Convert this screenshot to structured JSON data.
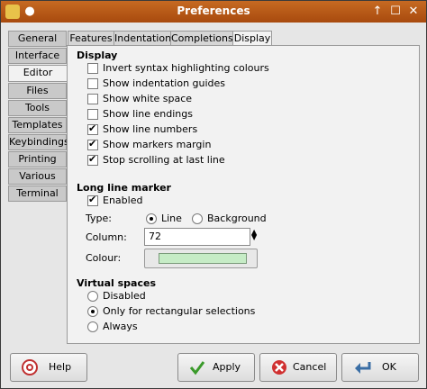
{
  "window": {
    "title": "Preferences"
  },
  "categories": [
    "General",
    "Interface",
    "Editor",
    "Files",
    "Tools",
    "Templates",
    "Keybindings",
    "Printing",
    "Various",
    "Terminal"
  ],
  "tabs": [
    "Features",
    "Indentation",
    "Completions",
    "Display"
  ],
  "display": {
    "heading": "Display",
    "options": [
      {
        "label": "Invert syntax highlighting colours",
        "checked": false
      },
      {
        "label": "Show indentation guides",
        "checked": false
      },
      {
        "label": "Show white space",
        "checked": false
      },
      {
        "label": "Show line endings",
        "checked": false
      },
      {
        "label": "Show line numbers",
        "checked": true
      },
      {
        "label": "Show markers margin",
        "checked": true
      },
      {
        "label": "Stop scrolling at last line",
        "checked": true
      }
    ]
  },
  "long_line": {
    "heading": "Long line marker",
    "enabled_label": "Enabled",
    "type_label": "Type:",
    "type_line": "Line",
    "type_background": "Background",
    "column_label": "Column:",
    "column_value": "72",
    "colour_label": "Colour:",
    "colour": "#c6ecc6"
  },
  "virtual": {
    "heading": "Virtual spaces",
    "options": [
      "Disabled",
      "Only for rectangular selections",
      "Always"
    ]
  },
  "buttons": {
    "help": "Help",
    "apply": "Apply",
    "cancel": "Cancel",
    "ok": "OK"
  },
  "colors": {
    "titlebar": "#b85a18",
    "accent": "#3a6ea5"
  }
}
